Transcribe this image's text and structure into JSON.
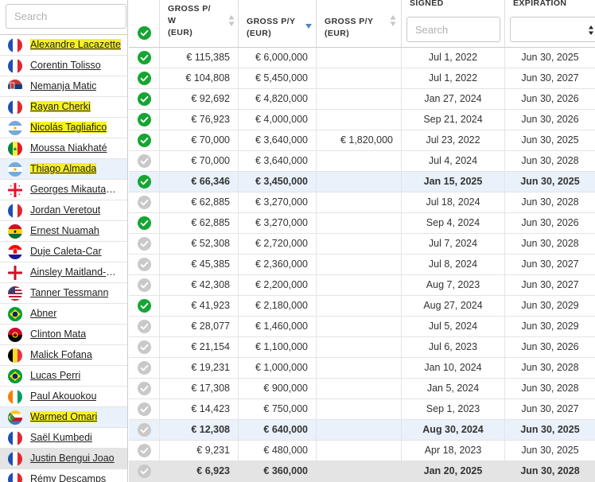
{
  "search": {
    "placeholder": "Search"
  },
  "columns": {
    "gross_pw": [
      "GROSS P/",
      "W",
      "(EUR)"
    ],
    "gross_py": [
      "GROSS P/Y",
      "(EUR)"
    ],
    "gross_py2": [
      "GROSS P/Y",
      "(EUR)"
    ],
    "signed": "SIGNED",
    "signed_placeholder": "Search",
    "expiration": "EXPIRATION",
    "expiration_selected": ""
  },
  "colors": {
    "accent_green": "#15a532",
    "check_gray": "#c9c9c9",
    "highlight": "#f6f21f",
    "selected_row": "#e9f1fa",
    "active_row": "#e4e4e4"
  },
  "players": [
    {
      "name": "Alexandre Lacazette",
      "flag": "france",
      "highlighted": true,
      "state": "normal"
    },
    {
      "name": "Corentin Tolisso",
      "flag": "france",
      "highlighted": false,
      "state": "normal"
    },
    {
      "name": "Nemanja Matic",
      "flag": "serbia",
      "highlighted": false,
      "state": "normal"
    },
    {
      "name": "Rayan Cherki",
      "flag": "france",
      "highlighted": true,
      "state": "normal"
    },
    {
      "name": "Nicolás Tagliafico",
      "flag": "argentina",
      "highlighted": true,
      "state": "normal"
    },
    {
      "name": "Moussa Niakhaté",
      "flag": "senegal",
      "highlighted": false,
      "state": "normal"
    },
    {
      "name": "Thiago Almada",
      "flag": "argentina",
      "highlighted": true,
      "state": "selected"
    },
    {
      "name": "Georges Mikautadze",
      "flag": "georgia",
      "highlighted": false,
      "state": "normal"
    },
    {
      "name": "Jordan Veretout",
      "flag": "france",
      "highlighted": false,
      "state": "normal"
    },
    {
      "name": "Ernest Nuamah",
      "flag": "ghana",
      "highlighted": false,
      "state": "normal"
    },
    {
      "name": "Duje Caleta-Car",
      "flag": "croatia",
      "highlighted": false,
      "state": "normal"
    },
    {
      "name": "Ainsley Maitland-N...",
      "flag": "england",
      "highlighted": false,
      "state": "normal"
    },
    {
      "name": "Tanner Tessmann",
      "flag": "usa",
      "highlighted": false,
      "state": "normal"
    },
    {
      "name": "Abner",
      "flag": "brazil",
      "highlighted": false,
      "state": "normal"
    },
    {
      "name": "Clinton Mata",
      "flag": "angola",
      "highlighted": false,
      "state": "normal"
    },
    {
      "name": "Malick Fofana",
      "flag": "belgium",
      "highlighted": false,
      "state": "normal"
    },
    {
      "name": "Lucas Perri",
      "flag": "brazil",
      "highlighted": false,
      "state": "normal"
    },
    {
      "name": "Paul Akouokou",
      "flag": "ivorycoast",
      "highlighted": false,
      "state": "normal"
    },
    {
      "name": "Warmed Omari",
      "flag": "comoros",
      "highlighted": true,
      "state": "selected"
    },
    {
      "name": "Saël Kumbedi",
      "flag": "france",
      "highlighted": false,
      "state": "normal"
    },
    {
      "name": "Justin Bengui Joao",
      "flag": "france",
      "highlighted": false,
      "state": "active"
    },
    {
      "name": "Rémy Descamps",
      "flag": "france",
      "highlighted": false,
      "state": "normal"
    }
  ],
  "rows": [
    {
      "check": true,
      "pw": "€ 115,385",
      "py": "€ 6,000,000",
      "py2": "",
      "signed": "Jul 1, 2022",
      "expiration": "Jun 30, 2025",
      "state": "normal"
    },
    {
      "check": true,
      "pw": "€ 104,808",
      "py": "€ 5,450,000",
      "py2": "",
      "signed": "Jul 1, 2022",
      "expiration": "Jun 30, 2027",
      "state": "normal"
    },
    {
      "check": true,
      "pw": "€ 92,692",
      "py": "€ 4,820,000",
      "py2": "",
      "signed": "Jan 27, 2024",
      "expiration": "Jun 30, 2026",
      "state": "normal"
    },
    {
      "check": true,
      "pw": "€ 76,923",
      "py": "€ 4,000,000",
      "py2": "",
      "signed": "Sep 21, 2024",
      "expiration": "Jun 30, 2026",
      "state": "normal"
    },
    {
      "check": true,
      "pw": "€ 70,000",
      "py": "€ 3,640,000",
      "py2": "€ 1,820,000",
      "signed": "Jul 23, 2022",
      "expiration": "Jun 30, 2025",
      "state": "normal"
    },
    {
      "check": false,
      "pw": "€ 70,000",
      "py": "€ 3,640,000",
      "py2": "",
      "signed": "Jul 4, 2024",
      "expiration": "Jun 30, 2028",
      "state": "normal"
    },
    {
      "check": true,
      "pw": "€ 66,346",
      "py": "€ 3,450,000",
      "py2": "",
      "signed": "Jan 15, 2025",
      "expiration": "Jun 30, 2025",
      "state": "selected"
    },
    {
      "check": false,
      "pw": "€ 62,885",
      "py": "€ 3,270,000",
      "py2": "",
      "signed": "Jul 18, 2024",
      "expiration": "Jun 30, 2028",
      "state": "normal"
    },
    {
      "check": true,
      "pw": "€ 62,885",
      "py": "€ 3,270,000",
      "py2": "",
      "signed": "Sep 4, 2024",
      "expiration": "Jun 30, 2026",
      "state": "normal"
    },
    {
      "check": false,
      "pw": "€ 52,308",
      "py": "€ 2,720,000",
      "py2": "",
      "signed": "Jul 7, 2024",
      "expiration": "Jun 30, 2028",
      "state": "normal"
    },
    {
      "check": false,
      "pw": "€ 45,385",
      "py": "€ 2,360,000",
      "py2": "",
      "signed": "Jul 8, 2024",
      "expiration": "Jun 30, 2027",
      "state": "normal"
    },
    {
      "check": false,
      "pw": "€ 42,308",
      "py": "€ 2,200,000",
      "py2": "",
      "signed": "Aug 7, 2023",
      "expiration": "Jun 30, 2027",
      "state": "normal"
    },
    {
      "check": true,
      "pw": "€ 41,923",
      "py": "€ 2,180,000",
      "py2": "",
      "signed": "Aug 27, 2024",
      "expiration": "Jun 30, 2029",
      "state": "normal"
    },
    {
      "check": false,
      "pw": "€ 28,077",
      "py": "€ 1,460,000",
      "py2": "",
      "signed": "Jul 5, 2024",
      "expiration": "Jun 30, 2029",
      "state": "normal"
    },
    {
      "check": false,
      "pw": "€ 21,154",
      "py": "€ 1,100,000",
      "py2": "",
      "signed": "Jul 6, 2023",
      "expiration": "Jun 30, 2026",
      "state": "normal"
    },
    {
      "check": false,
      "pw": "€ 19,231",
      "py": "€ 1,000,000",
      "py2": "",
      "signed": "Jan 10, 2024",
      "expiration": "Jun 30, 2028",
      "state": "normal"
    },
    {
      "check": false,
      "pw": "€ 17,308",
      "py": "€ 900,000",
      "py2": "",
      "signed": "Jan 5, 2024",
      "expiration": "Jun 30, 2028",
      "state": "normal"
    },
    {
      "check": false,
      "pw": "€ 14,423",
      "py": "€ 750,000",
      "py2": "",
      "signed": "Sep 1, 2023",
      "expiration": "Jun 30, 2027",
      "state": "normal"
    },
    {
      "check": false,
      "pw": "€ 12,308",
      "py": "€ 640,000",
      "py2": "",
      "signed": "Aug 30, 2024",
      "expiration": "Jun 30, 2025",
      "state": "selected"
    },
    {
      "check": false,
      "pw": "€ 9,231",
      "py": "€ 480,000",
      "py2": "",
      "signed": "Apr 18, 2023",
      "expiration": "Jun 30, 2025",
      "state": "normal"
    },
    {
      "check": false,
      "pw": "€ 6,923",
      "py": "€ 360,000",
      "py2": "",
      "signed": "Jan 20, 2025",
      "expiration": "Jun 30, 2028",
      "state": "active"
    }
  ]
}
